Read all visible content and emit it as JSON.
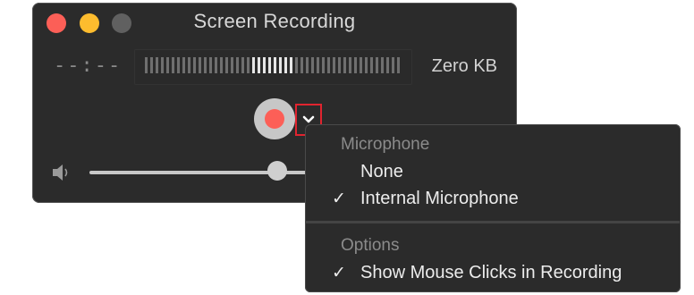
{
  "window": {
    "title": "Screen Recording",
    "elapsed_time": "--:--",
    "file_size": "Zero KB"
  },
  "controls": {
    "record_icon": "record-icon",
    "options_icon": "chevron-down-icon",
    "volume_icon": "speaker-icon",
    "volume_level": 0.75
  },
  "menu": {
    "sections": [
      {
        "header": "Microphone",
        "items": [
          {
            "label": "None",
            "checked": false
          },
          {
            "label": "Internal Microphone",
            "checked": true
          }
        ]
      },
      {
        "header": "Options",
        "items": [
          {
            "label": "Show Mouse Clicks in Recording",
            "checked": true
          }
        ]
      }
    ],
    "checkmark": "✓"
  },
  "colors": {
    "close": "#fc5f57",
    "minimize": "#fdbc2e",
    "maximize": "#606060",
    "record": "#fc5f57",
    "highlight_box": "#e0242f"
  }
}
